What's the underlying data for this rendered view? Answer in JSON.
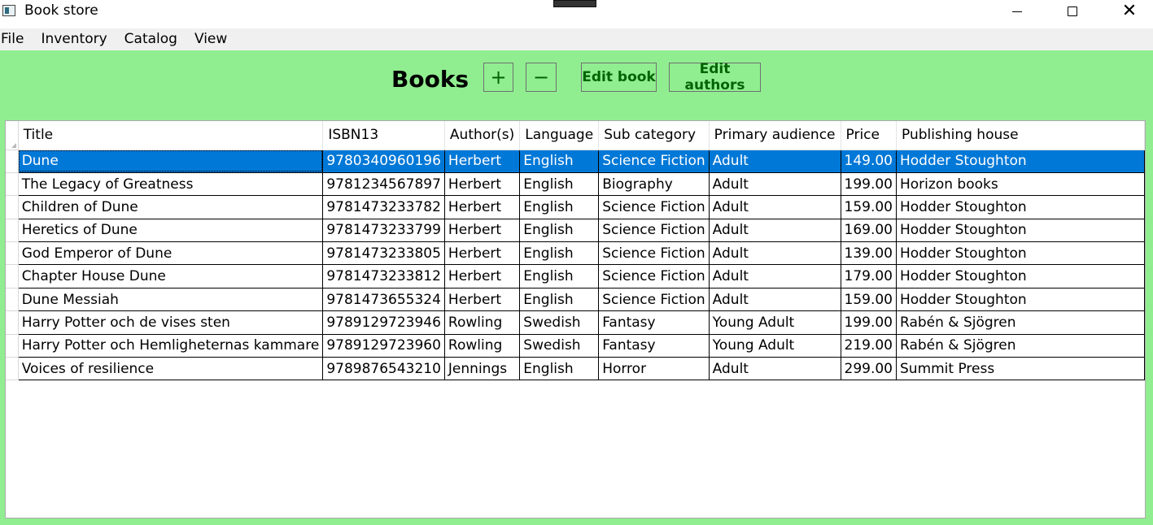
{
  "window": {
    "title": "Book store"
  },
  "menu": [
    "File",
    "Inventory",
    "Catalog",
    "View"
  ],
  "toolbar": {
    "heading": "Books",
    "add_label": "+",
    "remove_label": "−",
    "edit_book_label": "Edit book",
    "edit_authors_label": "Edit authors"
  },
  "table": {
    "columns": [
      "Title",
      "ISBN13",
      "Author(s)",
      "Language",
      "Sub category",
      "Primary audience",
      "Price",
      "Publishing house"
    ],
    "selected_row": 0,
    "rows": [
      [
        "Dune",
        "9780340960196",
        "Herbert",
        "English",
        "Science Fiction",
        "Adult",
        "149.00",
        "Hodder Stoughton"
      ],
      [
        "The Legacy of Greatness",
        "9781234567897",
        "Herbert",
        "English",
        "Biography",
        "Adult",
        "199.00",
        "Horizon books"
      ],
      [
        "Children of Dune",
        "9781473233782",
        "Herbert",
        "English",
        "Science Fiction",
        "Adult",
        "159.00",
        "Hodder Stoughton"
      ],
      [
        "Heretics of Dune",
        "9781473233799",
        "Herbert",
        "English",
        "Science Fiction",
        "Adult",
        "169.00",
        "Hodder Stoughton"
      ],
      [
        "God Emperor of Dune",
        "9781473233805",
        "Herbert",
        "English",
        "Science Fiction",
        "Adult",
        "139.00",
        "Hodder Stoughton"
      ],
      [
        "Chapter House Dune",
        "9781473233812",
        "Herbert",
        "English",
        "Science Fiction",
        "Adult",
        "179.00",
        "Hodder Stoughton"
      ],
      [
        "Dune Messiah",
        "9781473655324",
        "Herbert",
        "English",
        "Science Fiction",
        "Adult",
        "159.00",
        "Hodder Stoughton"
      ],
      [
        "Harry Potter och de vises sten",
        "9789129723946",
        "Rowling",
        "Swedish",
        "Fantasy",
        "Young Adult",
        "199.00",
        "Rabén & Sjögren"
      ],
      [
        "Harry Potter och Hemligheternas kammare",
        "9789129723960",
        "Rowling",
        "Swedish",
        "Fantasy",
        "Young Adult",
        "219.00",
        "Rabén & Sjögren"
      ],
      [
        "Voices of resilience",
        "9789876543210",
        "Jennings",
        "English",
        "Horror",
        "Adult",
        "299.00",
        "Summit Press"
      ]
    ]
  },
  "colors": {
    "background": "#90ee90",
    "button_text": "#006400",
    "selection": "#0078d7"
  }
}
